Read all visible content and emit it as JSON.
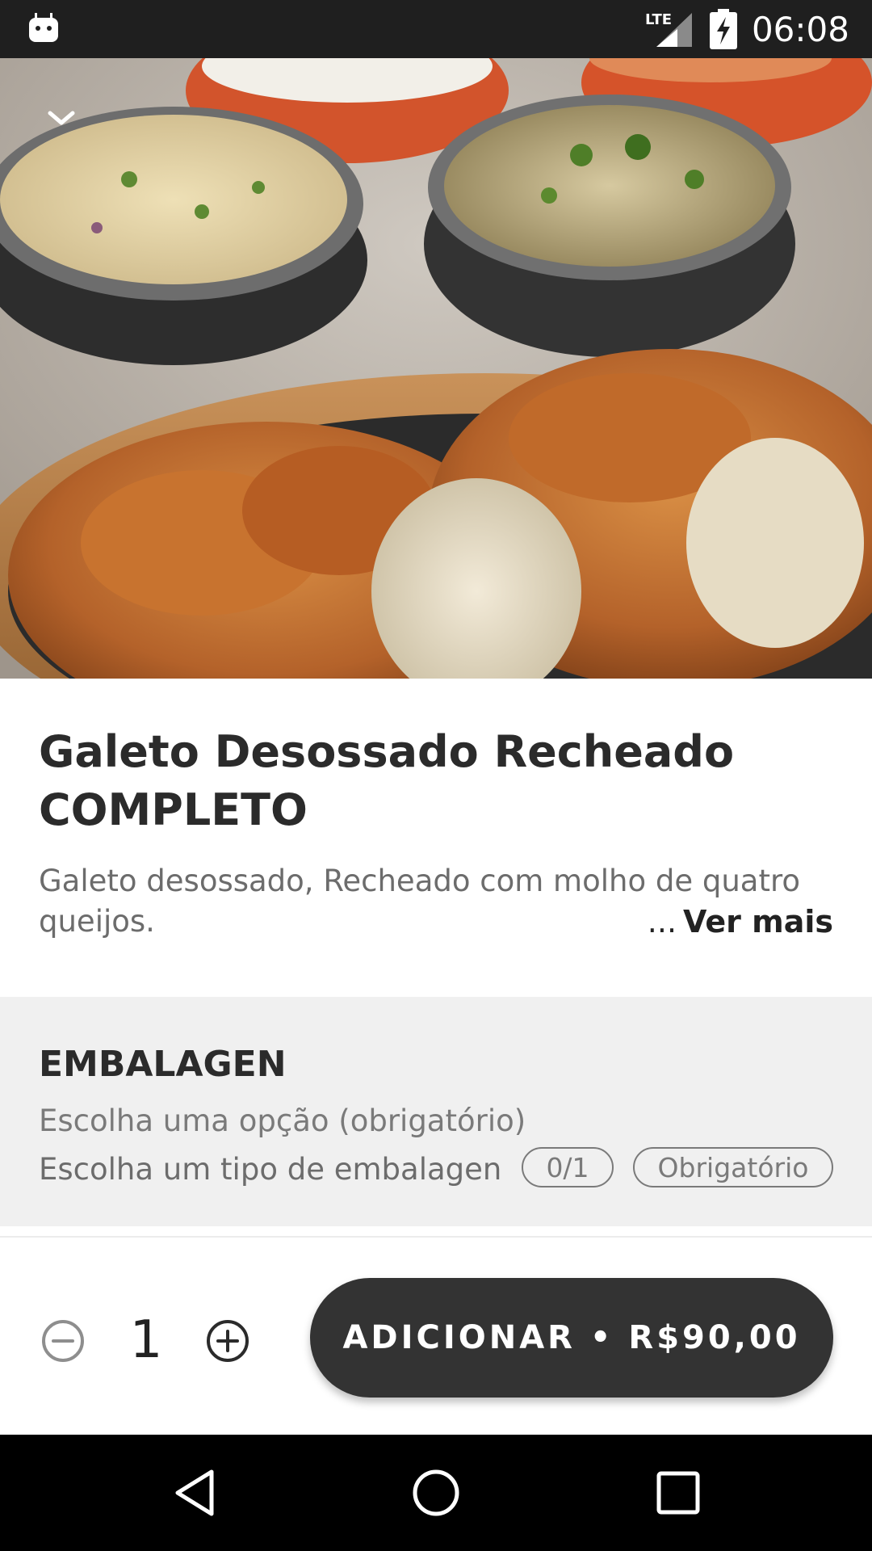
{
  "status_bar": {
    "network": "LTE",
    "time": "06:08"
  },
  "product": {
    "title_line1": "Galeto Desossado Recheado",
    "title_line2": "COMPLETO",
    "description": "Galeto desossado, Recheado com molho de quatro queijos.",
    "more_ellipsis": "...",
    "more_label": "Ver mais"
  },
  "option_group": {
    "title": "EMBALAGEN",
    "subtitle": "Escolha uma opção (obrigatório)",
    "instruction": "Escolha um tipo de embalagen",
    "selection_count": "0/1",
    "required_badge": "Obrigatório"
  },
  "cart": {
    "quantity": "1",
    "add_button_label": "ADICIONAR • R$90,00"
  },
  "icons": {
    "collapse": "chevron-down-icon",
    "decrease": "minus-circle-icon",
    "increase": "plus-circle-icon",
    "back": "back-triangle-icon",
    "home": "home-circle-icon",
    "recents": "recents-square-icon"
  },
  "colors": {
    "status_bar": "#1f1f1f",
    "button": "#333333",
    "section_bg": "#f0f0f0",
    "navbar": "#000000"
  }
}
